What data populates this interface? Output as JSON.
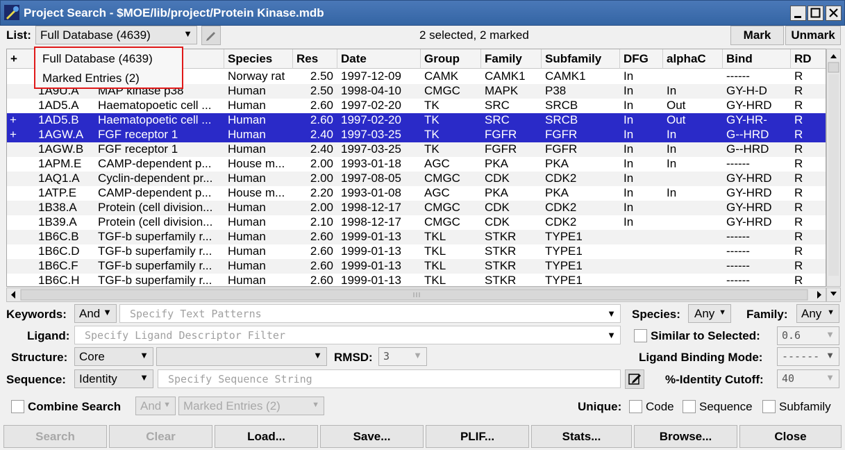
{
  "window": {
    "title": "Project Search - $MOE/lib/project/Protein Kinase.mdb"
  },
  "toolbar": {
    "list_label": "List:",
    "list_value": "Full Database (4639)",
    "status": "2 selected, 2 marked",
    "mark_label": "Mark",
    "unmark_label": "Unmark"
  },
  "list_dropdown": {
    "options": [
      "Full Database (4639)",
      "Marked Entries (2)"
    ]
  },
  "table": {
    "columns": [
      "+",
      "",
      "",
      "Species",
      "Res",
      "Date",
      "Group",
      "Family",
      "Subfamily",
      "DFG",
      "alphaC",
      "Bind",
      "RD"
    ],
    "rows": [
      [
        "",
        "",
        "ulin-...",
        "Norway rat",
        "2.50",
        "1997-12-09",
        "CAMK",
        "CAMK1",
        "CAMK1",
        "In",
        "",
        "------",
        "R"
      ],
      [
        "",
        "1A9U.A",
        "MAP kinase p38",
        "Human",
        "2.50",
        "1998-04-10",
        "CMGC",
        "MAPK",
        "P38",
        "In",
        "In",
        "GY-H-D",
        "R"
      ],
      [
        "",
        "1AD5.A",
        "Haematopoetic cell ...",
        "Human",
        "2.60",
        "1997-02-20",
        "TK",
        "SRC",
        "SRCB",
        "In",
        "Out",
        "GY-HRD",
        "R"
      ],
      [
        "+",
        "1AD5.B",
        "Haematopoetic cell ...",
        "Human",
        "2.60",
        "1997-02-20",
        "TK",
        "SRC",
        "SRCB",
        "In",
        "Out",
        "GY-HR-",
        "R"
      ],
      [
        "+",
        "1AGW.A",
        "FGF receptor 1",
        "Human",
        "2.40",
        "1997-03-25",
        "TK",
        "FGFR",
        "FGFR",
        "In",
        "In",
        "G--HRD",
        "R"
      ],
      [
        "",
        "1AGW.B",
        "FGF receptor 1",
        "Human",
        "2.40",
        "1997-03-25",
        "TK",
        "FGFR",
        "FGFR",
        "In",
        "In",
        "G--HRD",
        "R"
      ],
      [
        "",
        "1APM.E",
        "CAMP-dependent p...",
        "House m...",
        "2.00",
        "1993-01-18",
        "AGC",
        "PKA",
        "PKA",
        "In",
        "In",
        "------",
        "R"
      ],
      [
        "",
        "1AQ1.A",
        "Cyclin-dependent pr...",
        "Human",
        "2.00",
        "1997-08-05",
        "CMGC",
        "CDK",
        "CDK2",
        "In",
        "",
        "GY-HRD",
        "R"
      ],
      [
        "",
        "1ATP.E",
        "CAMP-dependent p...",
        "House m...",
        "2.20",
        "1993-01-08",
        "AGC",
        "PKA",
        "PKA",
        "In",
        "In",
        "GY-HRD",
        "R"
      ],
      [
        "",
        "1B38.A",
        "Protein (cell division...",
        "Human",
        "2.00",
        "1998-12-17",
        "CMGC",
        "CDK",
        "CDK2",
        "In",
        "",
        "GY-HRD",
        "R"
      ],
      [
        "",
        "1B39.A",
        "Protein (cell division...",
        "Human",
        "2.10",
        "1998-12-17",
        "CMGC",
        "CDK",
        "CDK2",
        "In",
        "",
        "GY-HRD",
        "R"
      ],
      [
        "",
        "1B6C.B",
        "TGF-b superfamily r...",
        "Human",
        "2.60",
        "1999-01-13",
        "TKL",
        "STKR",
        "TYPE1",
        "",
        "",
        "------",
        "R"
      ],
      [
        "",
        "1B6C.D",
        "TGF-b superfamily r...",
        "Human",
        "2.60",
        "1999-01-13",
        "TKL",
        "STKR",
        "TYPE1",
        "",
        "",
        "------",
        "R"
      ],
      [
        "",
        "1B6C.F",
        "TGF-b superfamily r...",
        "Human",
        "2.60",
        "1999-01-13",
        "TKL",
        "STKR",
        "TYPE1",
        "",
        "",
        "------",
        "R"
      ],
      [
        "",
        "1B6C.H",
        "TGF-b superfamily r...",
        "Human",
        "2.60",
        "1999-01-13",
        "TKL",
        "STKR",
        "TYPE1",
        "",
        "",
        "------",
        "R"
      ]
    ],
    "selected_row_indices": [
      3,
      4
    ]
  },
  "filters": {
    "keywords_label": "Keywords:",
    "keywords_mode": "And",
    "keywords_placeholder": "Specify Text Patterns",
    "species_label": "Species:",
    "species_value": "Any",
    "family_label": "Family:",
    "family_value": "Any",
    "ligand_label": "Ligand:",
    "ligand_placeholder": "Specify Ligand Descriptor Filter",
    "similar_label": "Similar to Selected:",
    "similar_value": "0.6",
    "structure_label": "Structure:",
    "structure_value": "Core",
    "structure_sub_value": "",
    "rmsd_label": "RMSD:",
    "rmsd_value": "3",
    "binding_mode_label": "Ligand Binding Mode:",
    "binding_mode_value": "------",
    "sequence_label": "Sequence:",
    "sequence_mode": "Identity",
    "sequence_placeholder": "Specify Sequence String",
    "identity_cutoff_label": "%-Identity Cutoff:",
    "identity_cutoff_value": "40",
    "combine_label": "Combine Search",
    "combine_mode": "And",
    "combine_list": "Marked Entries (2)",
    "unique_label": "Unique:",
    "unique_code": "Code",
    "unique_sequence": "Sequence",
    "unique_subfamily": "Subfamily"
  },
  "buttons": {
    "search": "Search",
    "clear": "Clear",
    "load": "Load...",
    "save": "Save...",
    "plif": "PLIF...",
    "stats": "Stats...",
    "browse": "Browse...",
    "close": "Close"
  }
}
